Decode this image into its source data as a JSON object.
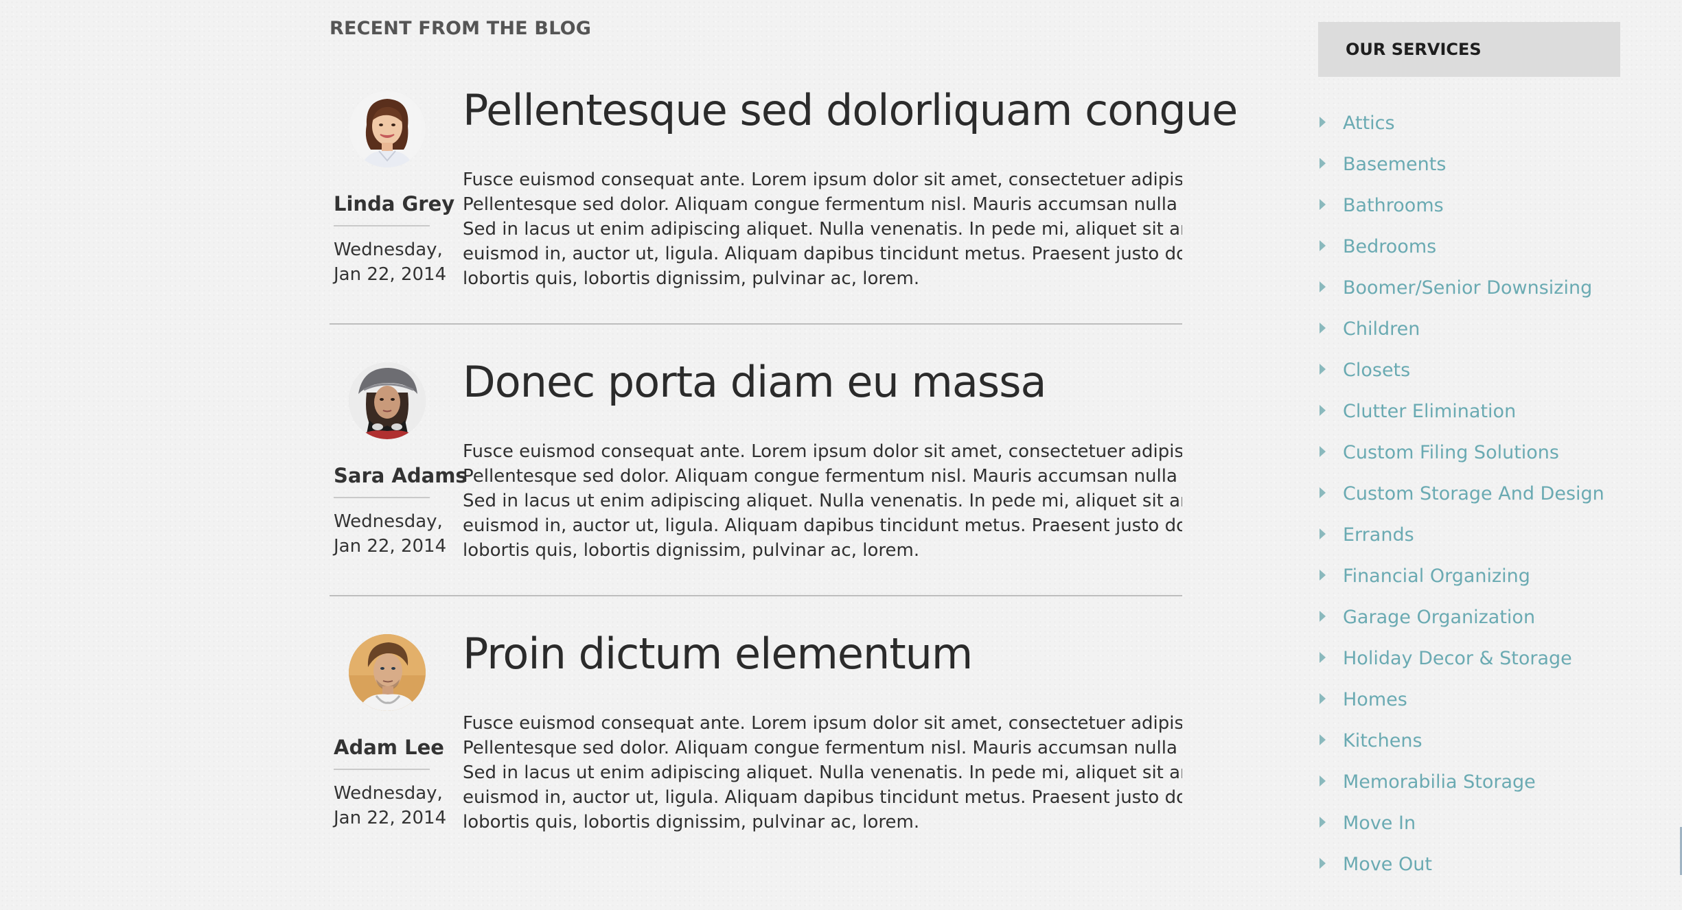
{
  "blog": {
    "heading": "RECENT FROM THE BLOG",
    "posts": [
      {
        "title": "Pellentesque sed dolorliquam congue",
        "author": "Linda Grey",
        "date_line1": "Wednesday,",
        "date_line2": "Jan 22, 2014",
        "avatar_icon": "woman-smiling-portrait",
        "excerpt_lines": [
          "Fusce euismod consequat ante. Lorem ipsum dolor sit amet, consectetuer adipiscing e",
          "Pellentesque sed dolor. Aliquam congue fermentum nisl. Mauris accumsan nulla vel di",
          "Sed in lacus ut enim adipiscing aliquet. Nulla venenatis. In pede mi, aliquet sit amet,",
          "euismod in, auctor ut, ligula. Aliquam dapibus tincidunt metus. Praesent justo dolor,",
          "lobortis quis, lobortis dignissim, pulvinar ac, lorem."
        ]
      },
      {
        "title": "Donec porta diam eu massa",
        "author": "Sara Adams",
        "date_line1": "Wednesday,",
        "date_line2": "Jan 22, 2014",
        "avatar_icon": "woman-with-cap-portrait",
        "excerpt_lines": [
          "Fusce euismod consequat ante. Lorem ipsum dolor sit amet, consectetuer adipiscing e",
          "Pellentesque sed dolor. Aliquam congue fermentum nisl. Mauris accumsan nulla vel di",
          "Sed in lacus ut enim adipiscing aliquet. Nulla venenatis. In pede mi, aliquet sit amet,",
          "euismod in, auctor ut, ligula. Aliquam dapibus tincidunt metus. Praesent justo dolor,",
          "lobortis quis, lobortis dignissim, pulvinar ac, lorem."
        ]
      },
      {
        "title": "Proin dictum elementum",
        "author": "Adam Lee",
        "date_line1": "Wednesday,",
        "date_line2": "Jan 22, 2014",
        "avatar_icon": "man-portrait",
        "excerpt_lines": [
          "Fusce euismod consequat ante. Lorem ipsum dolor sit amet, consectetuer adipiscing e",
          "Pellentesque sed dolor. Aliquam congue fermentum nisl. Mauris accumsan nulla vel di",
          "Sed in lacus ut enim adipiscing aliquet. Nulla venenatis. In pede mi, aliquet sit amet,",
          "euismod in, auctor ut, ligula. Aliquam dapibus tincidunt metus. Praesent justo dolor,",
          "lobortis quis, lobortis dignissim, pulvinar ac, lorem."
        ]
      }
    ]
  },
  "sidebar": {
    "title": "OUR SERVICES",
    "services": [
      "Attics",
      "Basements",
      "Bathrooms",
      "Bedrooms",
      "Boomer/Senior Downsizing",
      "Children",
      "Closets",
      "Clutter Elimination",
      "Custom Filing Solutions",
      "Custom Storage And Design",
      "Errands",
      "Financial Organizing",
      "Garage Organization",
      "Holiday Decor & Storage",
      "Homes",
      "Kitchens",
      "Memorabilia Storage",
      "Move In",
      "Move Out"
    ]
  },
  "colors": {
    "background": "#f2f2f2",
    "service_link": "#6aaab2",
    "bullet": "#8ab9bd",
    "sidebar_header_bg": "#dcdcdc"
  }
}
